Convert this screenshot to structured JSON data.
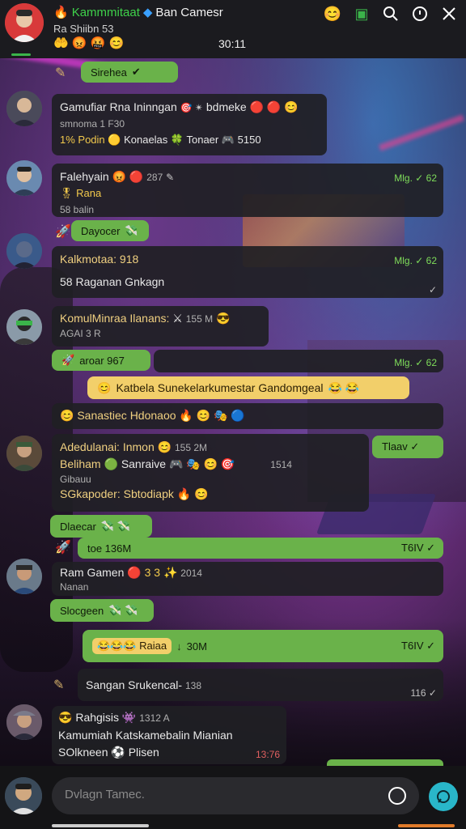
{
  "header": {
    "title_green": "Kammmitaat",
    "title_white": "Ban Camesr",
    "subtitle": "Ra Shiibn 53",
    "clock": "30:11",
    "emoji_row": "🤲 😡 🤬 😊"
  },
  "messages": [
    {
      "id": "m1",
      "type": "system",
      "text": "Sirehea"
    },
    {
      "id": "m2",
      "name": "Gamufiar Rna Ininngan",
      "tail": "bdmeke",
      "line2": "smnoma 1 F30",
      "line3_a": "1% Podin",
      "line3_b": "Konaelas",
      "line3_c": "Tonaer",
      "line3_d": "5150"
    },
    {
      "id": "m3",
      "name": "Falehyain",
      "stat": "287",
      "time": "Mlg. ✓ 62",
      "line2": "Rana",
      "line3": "58 balin"
    },
    {
      "id": "m4",
      "type": "system",
      "text": "Dayocer"
    },
    {
      "id": "m5",
      "name": "Kalkmotaa: 918",
      "time": "Mlg. ✓ 62",
      "line2": "58 Raganan Gnkagn"
    },
    {
      "id": "m6",
      "name": "KomulMinraa Ilanans:",
      "stat": "155 M",
      "line2": "AGAI 3 R"
    },
    {
      "id": "m7",
      "type": "system",
      "text": "aroar 967",
      "time": "Mlg. ✓ 62"
    },
    {
      "id": "m8",
      "type": "banner",
      "text": "Katbela Sunekelarkumestar Gandomgeal"
    },
    {
      "id": "m9",
      "text": "Sanastiec Hdonaoo"
    },
    {
      "id": "m10",
      "name": "Adedulanai: Inmon",
      "stat": "155 2M",
      "time": "Tlaav ✓",
      "line2": "Beliham",
      "line2b": "Sanraive",
      "line2c": "1514",
      "line3": "Gibauu",
      "line4": "SGkapoder: Sbtodiapk"
    },
    {
      "id": "m11",
      "type": "system",
      "text": "Dlaecar"
    },
    {
      "id": "m12",
      "type": "system",
      "text": "toe 136M",
      "time": "T6IV ✓"
    },
    {
      "id": "m13",
      "name": "Ram Gamen",
      "stat": "3 3",
      "stat2": "2014",
      "line2": "Nanan"
    },
    {
      "id": "m14",
      "type": "system",
      "text": "Slocgeen"
    },
    {
      "id": "m15",
      "type": "system",
      "text": "Raiaa",
      "stat": "30M",
      "time": "T6IV ✓"
    },
    {
      "id": "m16",
      "name": "Sangan Srukencal-",
      "stat": "138",
      "time": "116 ✓"
    },
    {
      "id": "m17",
      "name": "Rahgisis",
      "stat": "1312 A",
      "line2": "Kamumiah Katskamebalin Mianian",
      "line3": "SOlkneen",
      "line3b": "Plisen",
      "time": "13:76"
    }
  ],
  "composer": {
    "placeholder": "Dvlagn Tamec."
  },
  "colors": {
    "accent": "#3ed14a",
    "system_bubble": "#6ab24a",
    "banner": "#f2cf6a",
    "send": "#29b6c9"
  }
}
